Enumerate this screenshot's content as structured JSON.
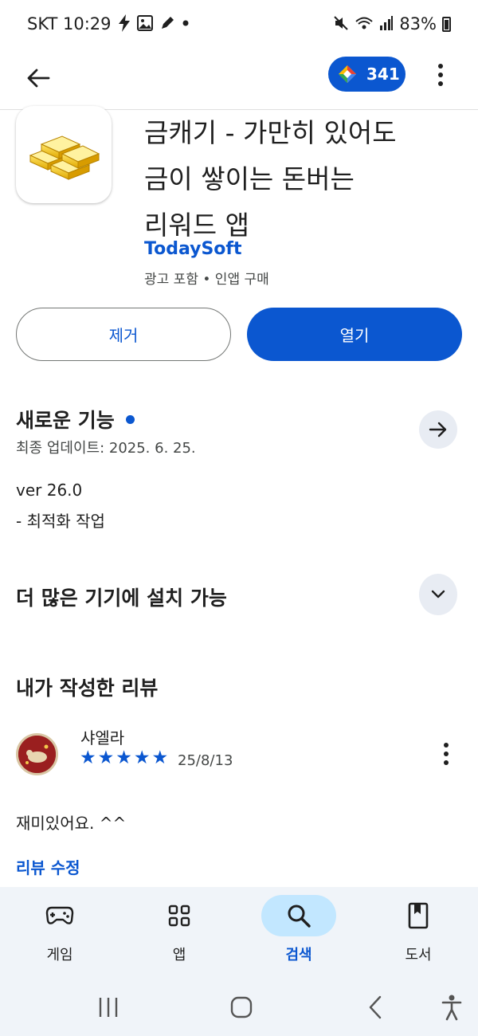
{
  "status_bar": {
    "carrier_time": "SKT 10:29",
    "battery": "83%",
    "icons": [
      "bolt-icon",
      "gallery-icon",
      "pen-icon",
      "dot-icon",
      "mute-icon",
      "wifi-icon",
      "signal-icon",
      "battery-icon"
    ]
  },
  "app_bar": {
    "points": "341"
  },
  "app": {
    "title_lines": [
      "금캐기 - 가만히 있어도",
      "금이 쌓이는 돈버는",
      "리워드 앱"
    ],
    "developer": "TodaySoft",
    "meta": "광고 포함 • 인앱 구매"
  },
  "buttons": {
    "uninstall": "제거",
    "open": "열기"
  },
  "whats_new": {
    "title": "새로운 기능",
    "updated": "최종 업데이트: 2025. 6. 25.",
    "version": "ver 26.0",
    "notes": "- 최적화 작업"
  },
  "devices": {
    "title": "더 많은 기기에 설치 가능"
  },
  "my_review": {
    "title": "내가 작성한 리뷰",
    "reviewer": "샤엘라",
    "rating": 5,
    "date": "25/8/13",
    "text": "재미있어요. ^^",
    "edit_label": "리뷰 수정"
  },
  "bottom_nav": {
    "items": [
      {
        "label": "게임",
        "icon": "gamepad-icon"
      },
      {
        "label": "앱",
        "icon": "apps-grid-icon"
      },
      {
        "label": "검색",
        "icon": "search-icon",
        "active": true
      },
      {
        "label": "도서",
        "icon": "book-icon"
      }
    ]
  },
  "colors": {
    "accent": "#0b57d0",
    "nav_bg": "#f0f4f9",
    "active_pill": "#c2e7ff"
  }
}
